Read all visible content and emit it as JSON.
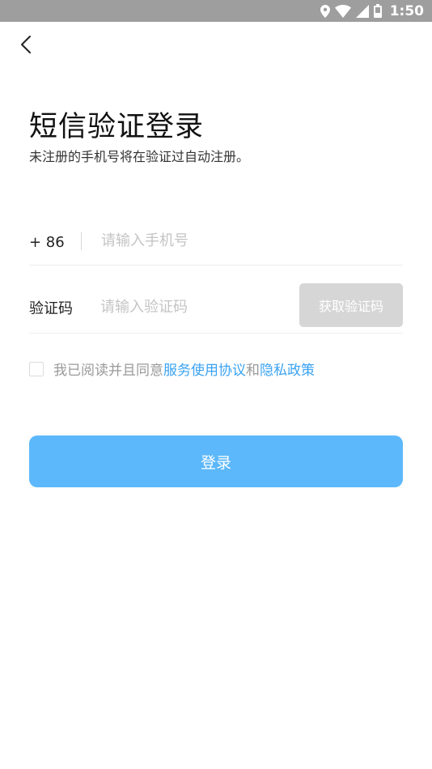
{
  "status_bar": {
    "time": "1:50",
    "icons": [
      "location-icon",
      "wifi-icon",
      "signal-icon",
      "battery-icon"
    ]
  },
  "header": {
    "back_icon": "back-arrow-icon"
  },
  "page": {
    "title": "短信验证登录",
    "subtitle": "未注册的手机号将在验证过自动注册。"
  },
  "phone": {
    "country_code": "+ 86",
    "value": "",
    "placeholder": "请输入手机号"
  },
  "code": {
    "label": "验证码",
    "value": "",
    "placeholder": "请输入验证码",
    "button_label": "获取验证码"
  },
  "agreement": {
    "prefix": "我已阅读并且同意",
    "service_link": "服务使用协议",
    "conjunction": "和",
    "privacy_link": "隐私政策",
    "checked": false
  },
  "login": {
    "button_label": "登录"
  },
  "colors": {
    "status_bar": "#9e9e9e",
    "accent": "#5cb8fa",
    "link": "#3aa3f2",
    "disabled_button": "#d6d6d6"
  }
}
